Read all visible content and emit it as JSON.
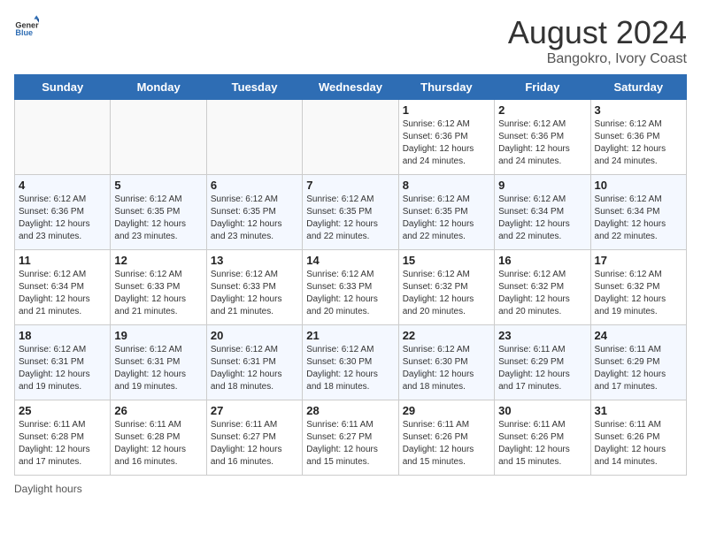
{
  "header": {
    "logo_general": "General",
    "logo_blue": "Blue",
    "title": "August 2024",
    "subtitle": "Bangokro, Ivory Coast"
  },
  "days_of_week": [
    "Sunday",
    "Monday",
    "Tuesday",
    "Wednesday",
    "Thursday",
    "Friday",
    "Saturday"
  ],
  "weeks": [
    [
      {
        "day": "",
        "info": ""
      },
      {
        "day": "",
        "info": ""
      },
      {
        "day": "",
        "info": ""
      },
      {
        "day": "",
        "info": ""
      },
      {
        "day": "1",
        "info": "Sunrise: 6:12 AM\nSunset: 6:36 PM\nDaylight: 12 hours and 24 minutes."
      },
      {
        "day": "2",
        "info": "Sunrise: 6:12 AM\nSunset: 6:36 PM\nDaylight: 12 hours and 24 minutes."
      },
      {
        "day": "3",
        "info": "Sunrise: 6:12 AM\nSunset: 6:36 PM\nDaylight: 12 hours and 24 minutes."
      }
    ],
    [
      {
        "day": "4",
        "info": "Sunrise: 6:12 AM\nSunset: 6:36 PM\nDaylight: 12 hours and 23 minutes."
      },
      {
        "day": "5",
        "info": "Sunrise: 6:12 AM\nSunset: 6:35 PM\nDaylight: 12 hours and 23 minutes."
      },
      {
        "day": "6",
        "info": "Sunrise: 6:12 AM\nSunset: 6:35 PM\nDaylight: 12 hours and 23 minutes."
      },
      {
        "day": "7",
        "info": "Sunrise: 6:12 AM\nSunset: 6:35 PM\nDaylight: 12 hours and 22 minutes."
      },
      {
        "day": "8",
        "info": "Sunrise: 6:12 AM\nSunset: 6:35 PM\nDaylight: 12 hours and 22 minutes."
      },
      {
        "day": "9",
        "info": "Sunrise: 6:12 AM\nSunset: 6:34 PM\nDaylight: 12 hours and 22 minutes."
      },
      {
        "day": "10",
        "info": "Sunrise: 6:12 AM\nSunset: 6:34 PM\nDaylight: 12 hours and 22 minutes."
      }
    ],
    [
      {
        "day": "11",
        "info": "Sunrise: 6:12 AM\nSunset: 6:34 PM\nDaylight: 12 hours and 21 minutes."
      },
      {
        "day": "12",
        "info": "Sunrise: 6:12 AM\nSunset: 6:33 PM\nDaylight: 12 hours and 21 minutes."
      },
      {
        "day": "13",
        "info": "Sunrise: 6:12 AM\nSunset: 6:33 PM\nDaylight: 12 hours and 21 minutes."
      },
      {
        "day": "14",
        "info": "Sunrise: 6:12 AM\nSunset: 6:33 PM\nDaylight: 12 hours and 20 minutes."
      },
      {
        "day": "15",
        "info": "Sunrise: 6:12 AM\nSunset: 6:32 PM\nDaylight: 12 hours and 20 minutes."
      },
      {
        "day": "16",
        "info": "Sunrise: 6:12 AM\nSunset: 6:32 PM\nDaylight: 12 hours and 20 minutes."
      },
      {
        "day": "17",
        "info": "Sunrise: 6:12 AM\nSunset: 6:32 PM\nDaylight: 12 hours and 19 minutes."
      }
    ],
    [
      {
        "day": "18",
        "info": "Sunrise: 6:12 AM\nSunset: 6:31 PM\nDaylight: 12 hours and 19 minutes."
      },
      {
        "day": "19",
        "info": "Sunrise: 6:12 AM\nSunset: 6:31 PM\nDaylight: 12 hours and 19 minutes."
      },
      {
        "day": "20",
        "info": "Sunrise: 6:12 AM\nSunset: 6:31 PM\nDaylight: 12 hours and 18 minutes."
      },
      {
        "day": "21",
        "info": "Sunrise: 6:12 AM\nSunset: 6:30 PM\nDaylight: 12 hours and 18 minutes."
      },
      {
        "day": "22",
        "info": "Sunrise: 6:12 AM\nSunset: 6:30 PM\nDaylight: 12 hours and 18 minutes."
      },
      {
        "day": "23",
        "info": "Sunrise: 6:11 AM\nSunset: 6:29 PM\nDaylight: 12 hours and 17 minutes."
      },
      {
        "day": "24",
        "info": "Sunrise: 6:11 AM\nSunset: 6:29 PM\nDaylight: 12 hours and 17 minutes."
      }
    ],
    [
      {
        "day": "25",
        "info": "Sunrise: 6:11 AM\nSunset: 6:28 PM\nDaylight: 12 hours and 17 minutes."
      },
      {
        "day": "26",
        "info": "Sunrise: 6:11 AM\nSunset: 6:28 PM\nDaylight: 12 hours and 16 minutes."
      },
      {
        "day": "27",
        "info": "Sunrise: 6:11 AM\nSunset: 6:27 PM\nDaylight: 12 hours and 16 minutes."
      },
      {
        "day": "28",
        "info": "Sunrise: 6:11 AM\nSunset: 6:27 PM\nDaylight: 12 hours and 15 minutes."
      },
      {
        "day": "29",
        "info": "Sunrise: 6:11 AM\nSunset: 6:26 PM\nDaylight: 12 hours and 15 minutes."
      },
      {
        "day": "30",
        "info": "Sunrise: 6:11 AM\nSunset: 6:26 PM\nDaylight: 12 hours and 15 minutes."
      },
      {
        "day": "31",
        "info": "Sunrise: 6:11 AM\nSunset: 6:26 PM\nDaylight: 12 hours and 14 minutes."
      }
    ]
  ],
  "footer": {
    "daylight_label": "Daylight hours"
  }
}
